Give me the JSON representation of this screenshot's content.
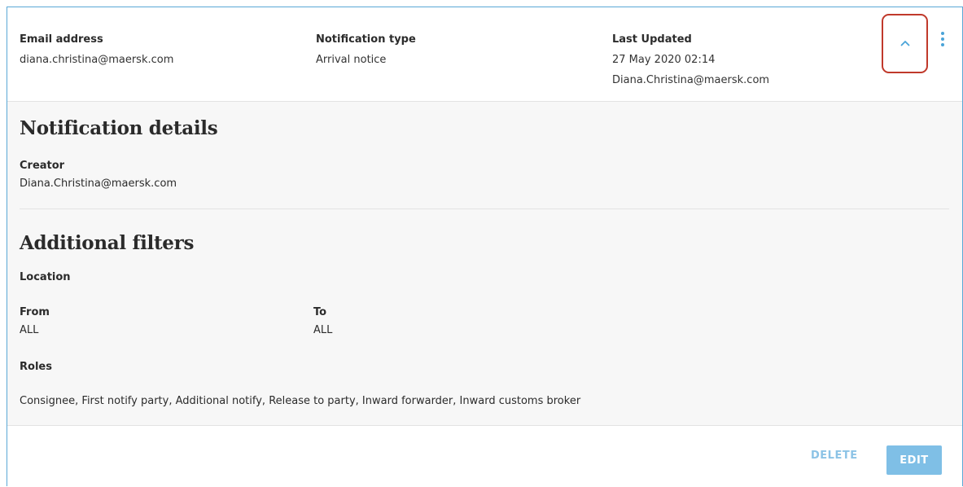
{
  "summary": {
    "email_label": "Email address",
    "email_value": "diana.christina@maersk.com",
    "type_label": "Notification type",
    "type_value": "Arrival notice",
    "updated_label": "Last Updated",
    "updated_date": "27 May 2020 02:14",
    "updated_by": "Diana.Christina@maersk.com",
    "collapse_icon": "chevron-up-icon",
    "more_icon": "more-vertical-icon"
  },
  "details": {
    "title": "Notification details",
    "creator_label": "Creator",
    "creator_value": "Diana.Christina@maersk.com"
  },
  "filters": {
    "title": "Additional filters",
    "location_label": "Location",
    "from_label": "From",
    "from_value": "ALL",
    "to_label": "To",
    "to_value": "ALL",
    "roles_label": "Roles",
    "roles_value": "Consignee, First notify party, Additional notify, Release to party, Inward forwarder, Inward customs broker"
  },
  "actions": {
    "delete_label": "DELETE",
    "edit_label": "EDIT"
  },
  "colors": {
    "accent": "#4aa4d8",
    "highlight_border": "#c0392b",
    "edit_button_bg": "#7fbfe6"
  }
}
